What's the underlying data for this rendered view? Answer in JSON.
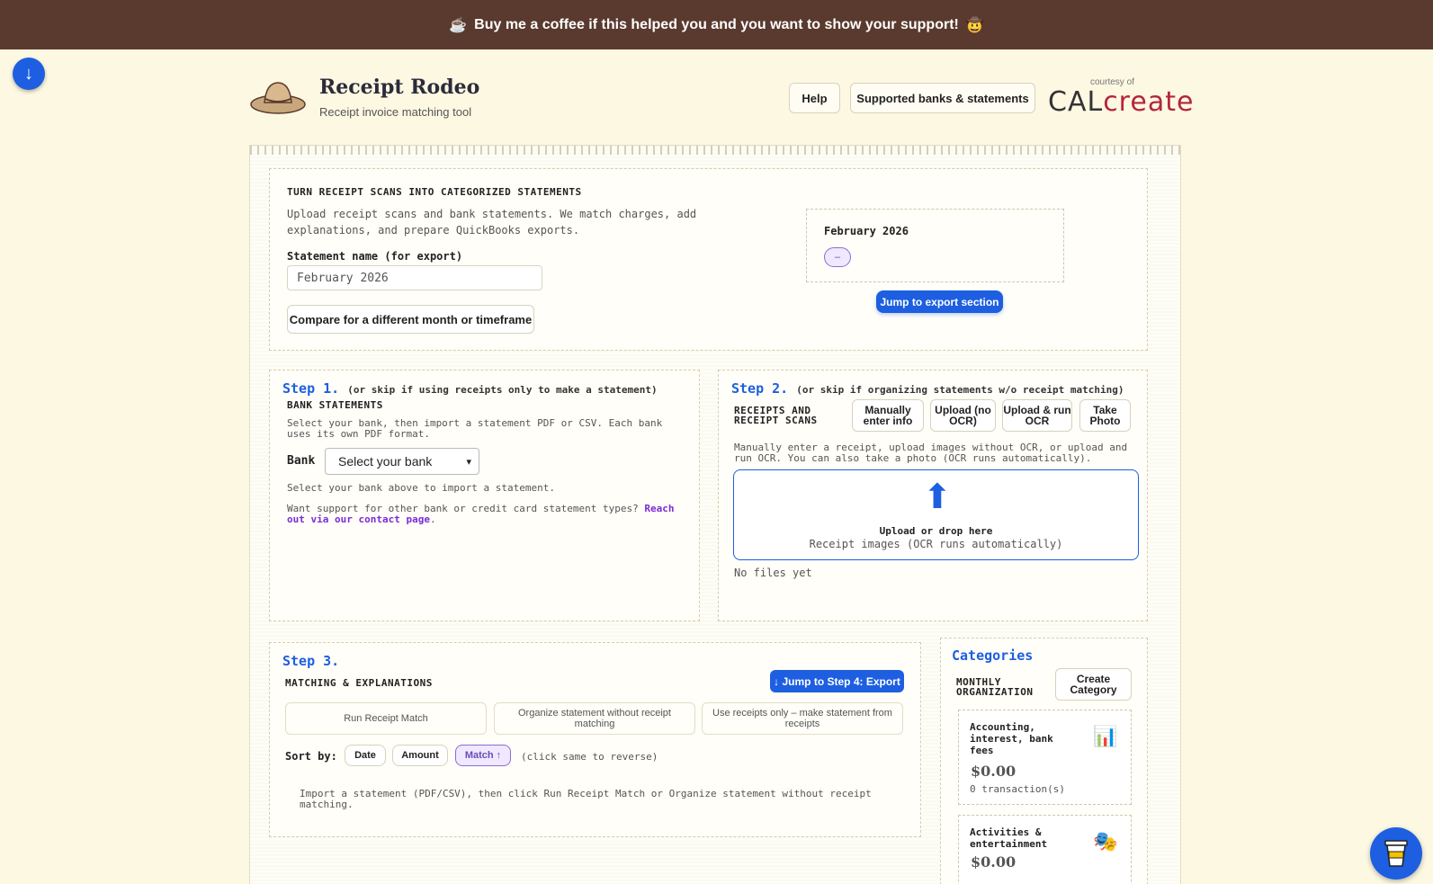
{
  "banner": {
    "icon": "☕",
    "text": "Buy me a coffee if this helped you and you want to show your support!",
    "emoji": "🤠"
  },
  "header": {
    "title": "Receipt Rodeo",
    "subtitle": "Receipt invoice matching tool",
    "help_label": "Help",
    "banks_label": "Supported banks & statements",
    "courtesy": "courtesy of",
    "brand_a": "CAL",
    "brand_b": "create"
  },
  "intro": {
    "kicker": "TURN RECEIPT SCANS INTO CATEGORIZED STATEMENTS",
    "description": "Upload receipt scans and bank statements. We match charges, add explanations, and prepare QuickBooks exports.",
    "field_label": "Statement name (for export)",
    "field_value": "February 2026",
    "compare_label": "Compare for a different month or timeframe",
    "month_title": "February 2026",
    "month_pill": "–",
    "export_jump": "Jump to export section"
  },
  "step1": {
    "step": "Step 1.",
    "note": "(or skip if using receipts only to make a statement)",
    "kicker": "BANK STATEMENTS",
    "description": "Select your bank, then import a statement PDF or CSV. Each bank uses its own PDF format.",
    "bank_label": "Bank",
    "bank_select": "Select your bank",
    "hint": "Select your bank above to import a statement.",
    "support_text": "Want support for other bank or credit card statement types? ",
    "support_link": "Reach out via our contact page",
    "support_end": "."
  },
  "step2": {
    "step": "Step 2.",
    "note": "(or skip if organizing statements w/o receipt matching)",
    "kicker": "RECEIPTS AND RECEIPT SCANS",
    "buttons": [
      "Manually enter info",
      "Upload (no OCR)",
      "Upload & run OCR",
      "Take Photo"
    ],
    "description": "Manually enter a receipt, upload images without OCR, or upload and run OCR. You can also take a photo (OCR runs automatically).",
    "drop_title": "Upload or drop here",
    "drop_sub": "Receipt images (OCR runs automatically)",
    "no_files": "No files yet"
  },
  "step3": {
    "step": "Step 3.",
    "kicker": "MATCHING & EXPLANATIONS",
    "jump4": "↓ Jump to Step 4: Export",
    "modes": [
      "Run Receipt Match",
      "Organize statement without receipt matching",
      "Use receipts only – make statement from receipts"
    ],
    "sort_label": "Sort by:",
    "sort_options": [
      "Date",
      "Amount",
      "Match ↑"
    ],
    "sort_note": "(click same to reverse)",
    "description": "Import a statement (PDF/CSV), then click Run Receipt Match or Organize statement without receipt matching."
  },
  "categories": {
    "title": "Categories",
    "kicker": "MONTHLY ORGANIZATION",
    "create_label": "Create Category",
    "items": [
      {
        "name": "Accounting, interest, bank fees",
        "amount": "$0.00",
        "count": "0 transaction(s)",
        "icon": "📊"
      },
      {
        "name": "Activities & entertainment",
        "amount": "$0.00",
        "icon": "🎭"
      }
    ]
  },
  "scroll_down": "↓"
}
